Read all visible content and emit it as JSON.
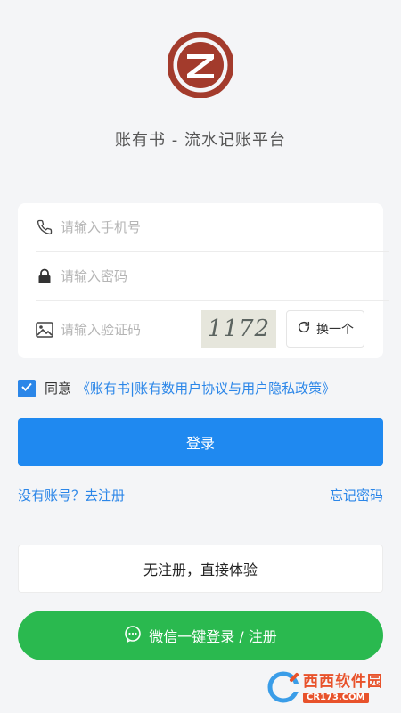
{
  "app": {
    "title": "账有书 - 流水记账平台"
  },
  "form": {
    "phone_placeholder": "请输入手机号",
    "password_placeholder": "请输入密码",
    "captcha_placeholder": "请输入验证码",
    "captcha_value": "1172",
    "refresh_label": "换一个"
  },
  "agreement": {
    "checked": true,
    "agree_label": "同意",
    "link_label": "《账有书|账有数用户协议与用户隐私政策》"
  },
  "actions": {
    "login_label": "登录",
    "register_link": "没有账号？去注册",
    "forgot_link": "忘记密码",
    "guest_label": "无注册，直接体验",
    "wechat_label": "微信一键登录 / 注册"
  },
  "watermark": {
    "main": "西西软件园",
    "sub": "CR173.COM"
  },
  "colors": {
    "brand_red": "#a33b2c",
    "primary_blue": "#1f89f0",
    "link_blue": "#2b86e8",
    "wechat_green": "#2ab94f",
    "background": "#f4f5f7"
  },
  "icons": {
    "phone": "phone-icon",
    "password": "lock-icon",
    "captcha": "image-icon",
    "refresh": "refresh-icon",
    "wechat": "wechat-icon",
    "check": "check-icon"
  }
}
